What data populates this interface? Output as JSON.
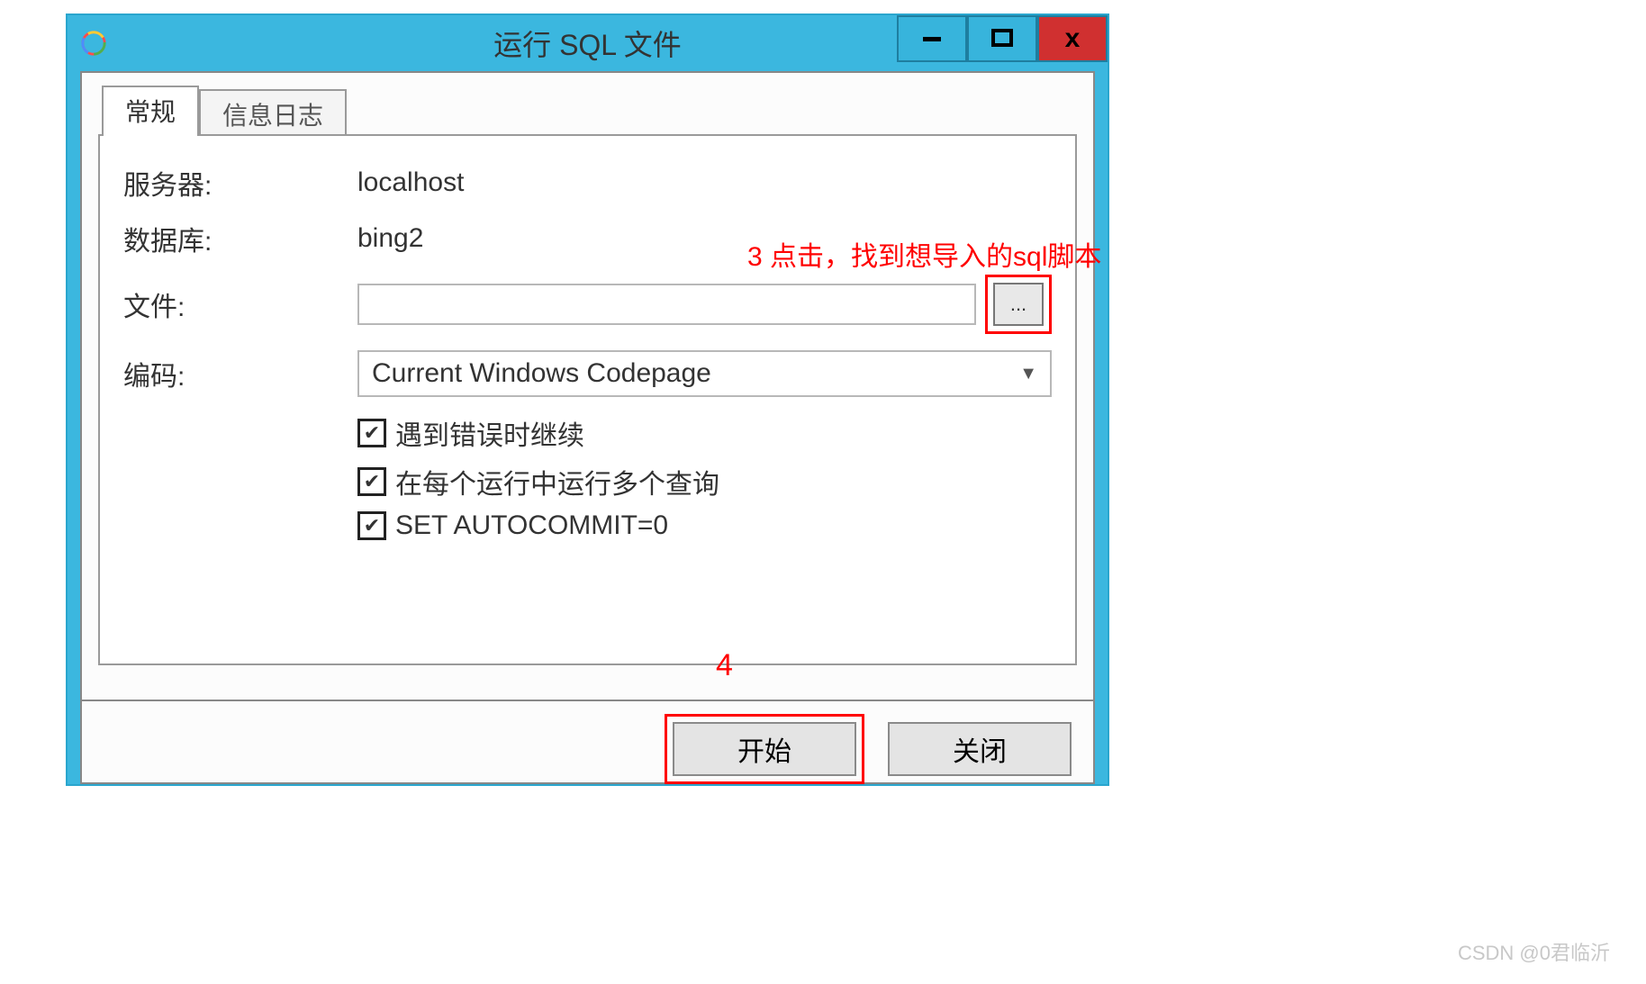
{
  "window": {
    "title": "运行 SQL 文件"
  },
  "tabs": {
    "general": "常规",
    "log": "信息日志"
  },
  "labels": {
    "server": "服务器:",
    "database": "数据库:",
    "file": "文件:",
    "encoding": "编码:"
  },
  "values": {
    "server": "localhost",
    "database": "bing2",
    "file": "",
    "encoding": "Current Windows Codepage",
    "browse": "..."
  },
  "checks": {
    "continue_on_error": "遇到错误时继续",
    "multi_query": "在每个运行中运行多个查询",
    "autocommit": "SET AUTOCOMMIT=0"
  },
  "buttons": {
    "start": "开始",
    "close": "关闭"
  },
  "annotations": {
    "step3": "3 点击，找到想导入的sql脚本",
    "step4": "4"
  },
  "watermark": "CSDN @0君临沂"
}
